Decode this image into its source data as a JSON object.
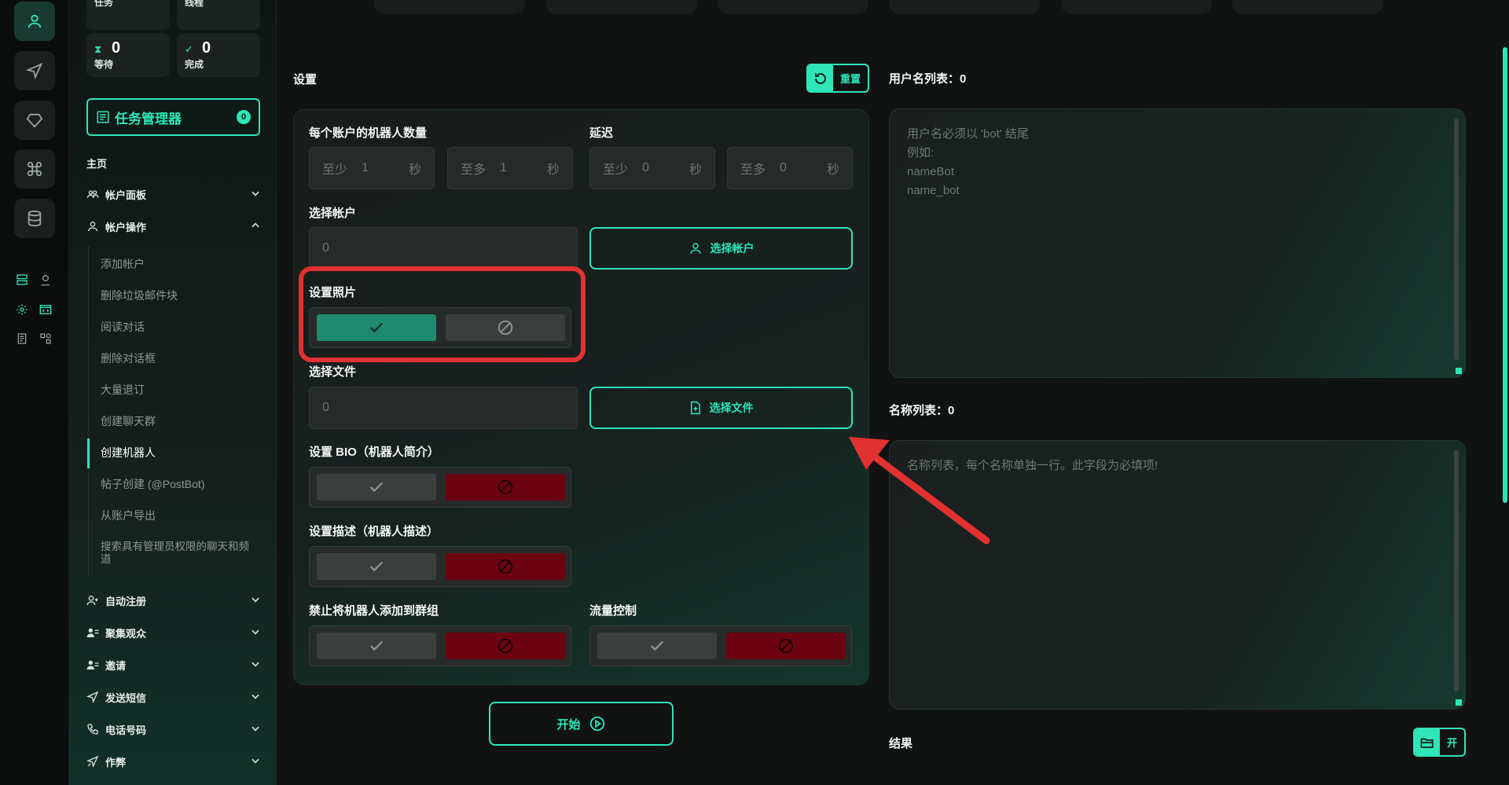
{
  "stats": [
    {
      "label": "任务",
      "value": ""
    },
    {
      "label": "线程",
      "value": ""
    },
    {
      "label": "等待",
      "value": "0"
    },
    {
      "label": "完成",
      "value": "0"
    }
  ],
  "task_manager": {
    "label": "任务管理器",
    "count": "0"
  },
  "sidebar": {
    "home": "主页",
    "sections": [
      {
        "label": "帐户面板",
        "icon": "users-icon"
      },
      {
        "label": "帐户操作",
        "icon": "user-icon"
      }
    ],
    "sub_items": [
      "添加帐户",
      "删除垃圾邮件块",
      "阅读对话",
      "删除对话框",
      "大量退订",
      "创建聊天群",
      "创建机器人",
      "帖子创建 (@PostBot)",
      "从账户导出",
      "搜索具有管理员权限的聊天和频道"
    ],
    "active_sub": "创建机器人",
    "more_sections": [
      {
        "label": "自动注册",
        "icon": "user-plus-icon"
      },
      {
        "label": "聚集观众",
        "icon": "users-list-icon"
      },
      {
        "label": "邀请",
        "icon": "invite-icon"
      },
      {
        "label": "发送短信",
        "icon": "send-icon"
      },
      {
        "label": "电话号码",
        "icon": "phone-icon"
      },
      {
        "label": "作弊",
        "icon": "cheat-icon"
      }
    ]
  },
  "settings": {
    "title": "设置",
    "reset_label": "重置",
    "bots_per_account_label": "每个账户的机器人数量",
    "delay_label": "延迟",
    "min_prefix": "至少",
    "max_prefix": "至多",
    "bots_min": "1",
    "bots_max": "1",
    "delay_min": "0",
    "delay_max": "0",
    "seconds_suffix": "秒",
    "select_account_label": "选择帐户",
    "select_account_value": "0",
    "select_account_button": "选择帐户",
    "set_photo_label": "设置照片",
    "select_file_label": "选择文件",
    "select_file_value": "0",
    "select_file_button": "选择文件",
    "set_bio_label": "设置 BIO（机器人简介）",
    "set_description_label": "设置描述（机器人描述）",
    "forbid_groups_label": "禁止将机器人添加到群组",
    "flow_control_label": "流量控制",
    "start_label": "开始"
  },
  "usernames": {
    "title": "用户名列表：0",
    "placeholder_lines": [
      "用户名必须以 'bot' 结尾",
      "例如:",
      "nameBot",
      "name_bot"
    ]
  },
  "names": {
    "title": "名称列表：0",
    "placeholder": "名称列表，每个名称单独一行。此字段为必填项!"
  },
  "results": {
    "title": "结果",
    "open_label": "开"
  },
  "colors": {
    "accent": "#2ee6b8",
    "highlight": "#e23131",
    "deny": "#6b0410"
  }
}
